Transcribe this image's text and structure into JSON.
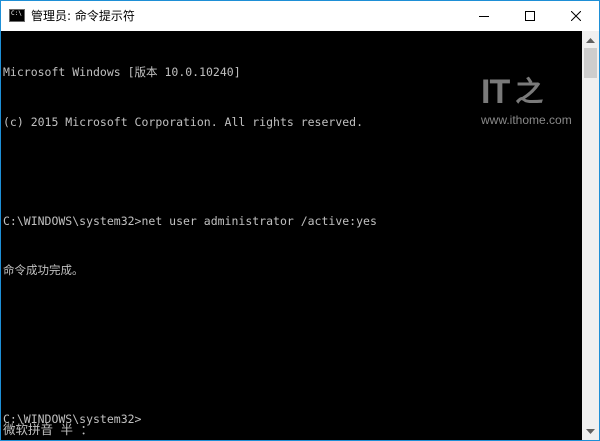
{
  "window": {
    "title": "管理员: 命令提示符",
    "icon": "cmd-icon",
    "icon_text": "C:\\"
  },
  "caption_buttons": {
    "minimize": "minimize-icon",
    "maximize": "maximize-icon",
    "close": "close-icon"
  },
  "console": {
    "lines": [
      "Microsoft Windows [版本 10.0.10240]",
      "(c) 2015 Microsoft Corporation. All rights reserved.",
      "",
      "C:\\WINDOWS\\system32>net user administrator /active:yes",
      "命令成功完成。",
      "",
      "",
      "C:\\WINDOWS\\system32>"
    ],
    "ime_status": "微软拼音 半 ："
  },
  "watermark": {
    "logo_text": "IT",
    "logo_glyph": "之",
    "url": "www.ithome.com"
  },
  "colors": {
    "console_bg": "#000000",
    "console_fg": "#c0c0c0",
    "accent_border": "#1e8fd6"
  }
}
